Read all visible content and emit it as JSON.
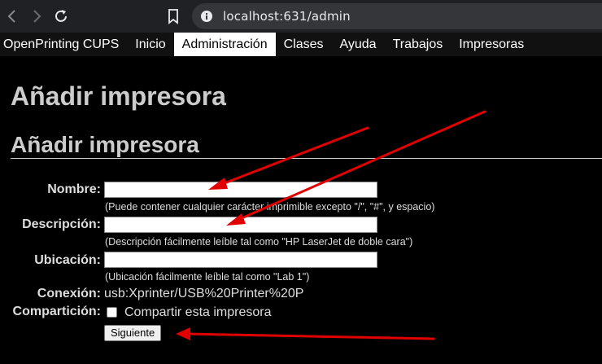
{
  "browser": {
    "url": "localhost:631/admin",
    "icons": [
      "back-icon",
      "forward-icon",
      "reload-icon",
      "bookmark-icon",
      "site-info-icon"
    ]
  },
  "menu": {
    "items": [
      "OpenPrinting CUPS",
      "Inicio",
      "Administración",
      "Clases",
      "Ayuda",
      "Trabajos",
      "Impresoras"
    ],
    "active_index": 2
  },
  "page": {
    "title": "Añadir impresora",
    "heading": "Añadir impresora"
  },
  "form": {
    "name_label": "Nombre:",
    "name_value": "",
    "name_hint": "(Puede contener cualquier carácter imprimible excepto \"/\", \"#\", y espacio)",
    "description_label": "Descripción:",
    "description_value": "",
    "description_hint": "(Descripción fácilmente leíble tal como \"HP LaserJet de doble cara\")",
    "location_label": "Ubicación:",
    "location_value": "",
    "location_hint": "(Ubicación fácilmente leíble tal como \"Lab 1\")",
    "connection_label": "Conexión:",
    "connection_value": "usb:Xprinter/USB%20Printer%20P",
    "sharing_label": "Compartición:",
    "share_checked": false,
    "share_text": "Compartir esta impresora",
    "submit_label": "Siguiente"
  },
  "annotations": {
    "arrow_color": "#e00000",
    "count": 3
  }
}
